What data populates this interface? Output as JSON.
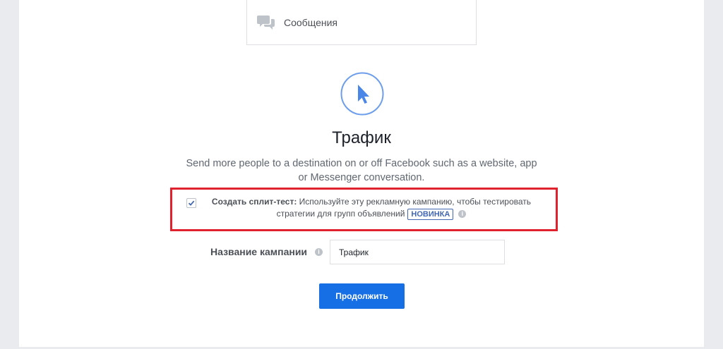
{
  "objective_card": {
    "icon": "chat-bubbles-icon",
    "label": "Сообщения"
  },
  "hero": {
    "icon": "cursor-arrow-icon",
    "accent": "#4a86e8"
  },
  "title": "Трафик",
  "description": "Send more people to a destination on or off Facebook such as a website, app or Messenger conversation.",
  "split_test": {
    "checked": true,
    "label_bold": "Создать сплит-тест:",
    "label_text": " Используйте эту рекламную кампанию, чтобы тестировать стратегии для групп объявлений",
    "badge": "НОВИНКА",
    "info_icon": "info-icon"
  },
  "campaign_name": {
    "label": "Название кампании",
    "info_icon": "info-icon",
    "value": "Трафик"
  },
  "continue_button": {
    "label": "Продолжить",
    "color": "#166fe5"
  },
  "highlight_color": "#e0212e"
}
